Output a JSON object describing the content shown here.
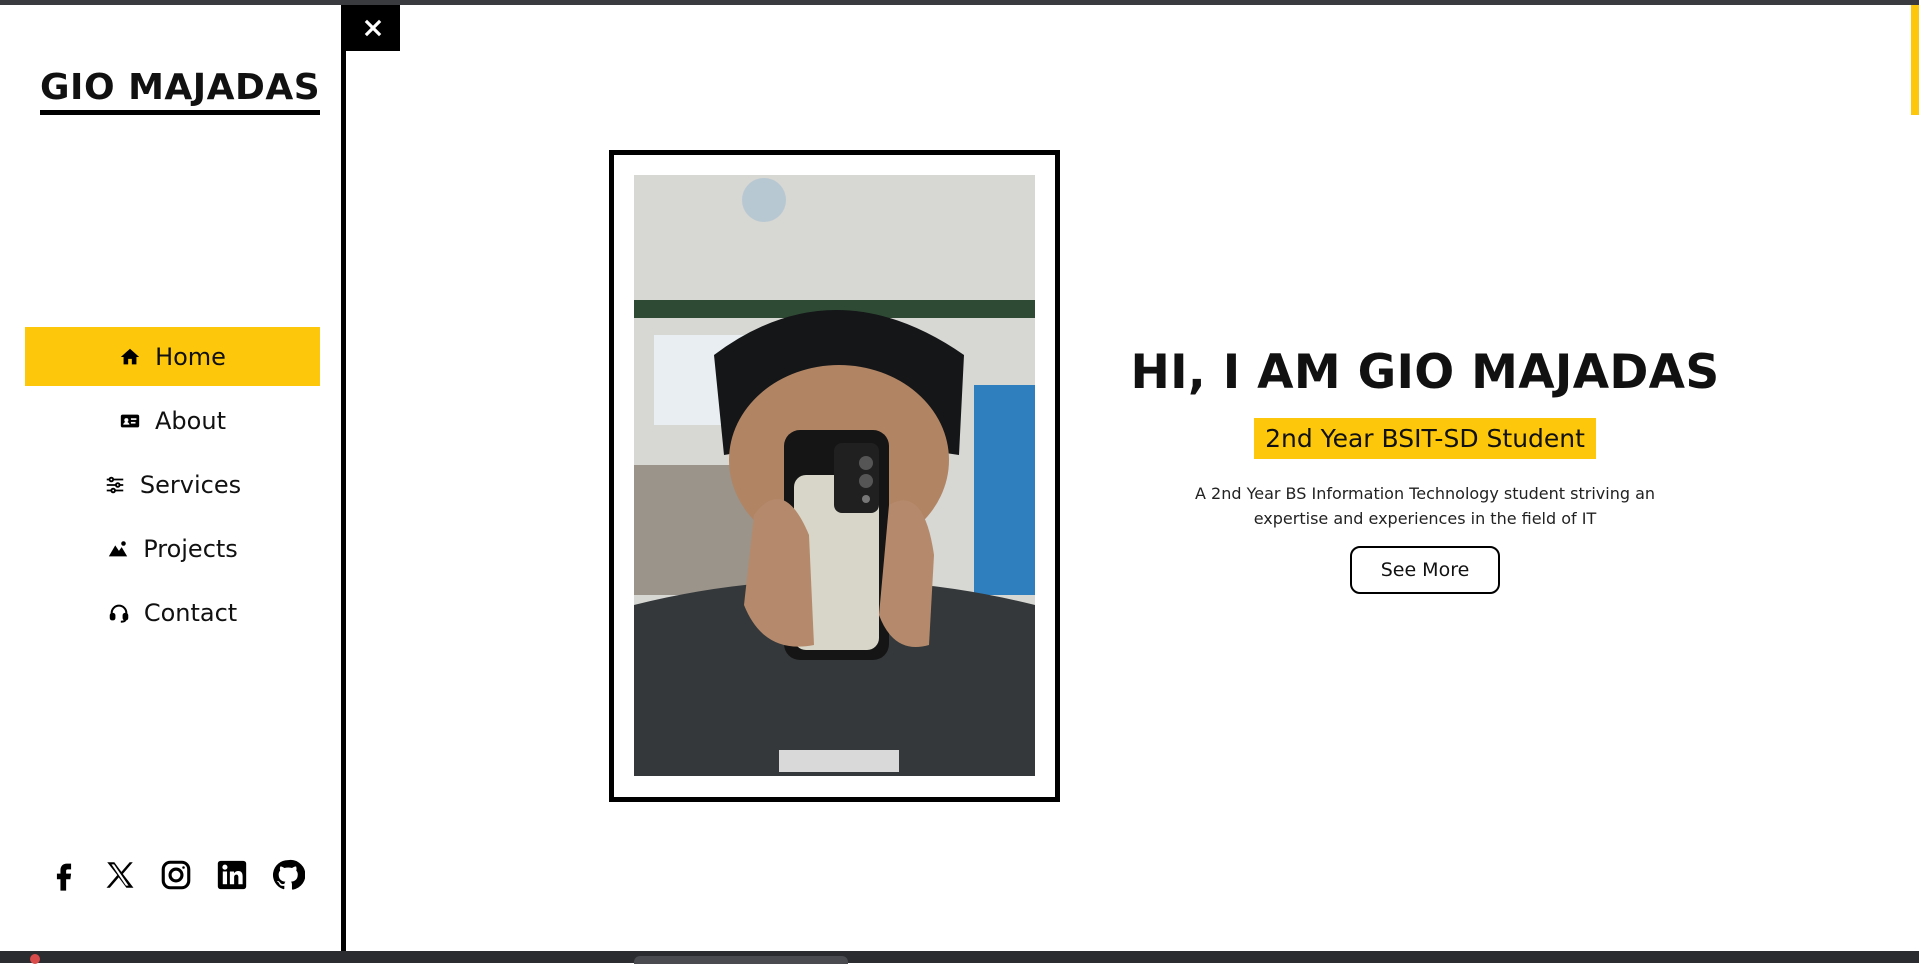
{
  "brand": {
    "name": "GIO MAJADAS"
  },
  "nav": {
    "items": [
      {
        "label": "Home",
        "icon": "home-icon",
        "active": true
      },
      {
        "label": "About",
        "icon": "id-card-icon",
        "active": false
      },
      {
        "label": "Services",
        "icon": "sliders-icon",
        "active": false
      },
      {
        "label": "Projects",
        "icon": "mountain-image-icon",
        "active": false
      },
      {
        "label": "Contact",
        "icon": "headset-icon",
        "active": false
      }
    ]
  },
  "socials": [
    "facebook-icon",
    "x-icon",
    "instagram-icon",
    "linkedin-icon",
    "github-icon"
  ],
  "hero": {
    "title": "HI, I AM GIO MAJADAS",
    "badge": "2nd Year BSIT-SD Student",
    "description": "A 2nd Year BS Information Technology student striving an expertise and experiences in the field of IT",
    "button": "See More"
  },
  "colors": {
    "accent": "#fdc80b",
    "border": "#000000",
    "background": "#ffffff"
  }
}
